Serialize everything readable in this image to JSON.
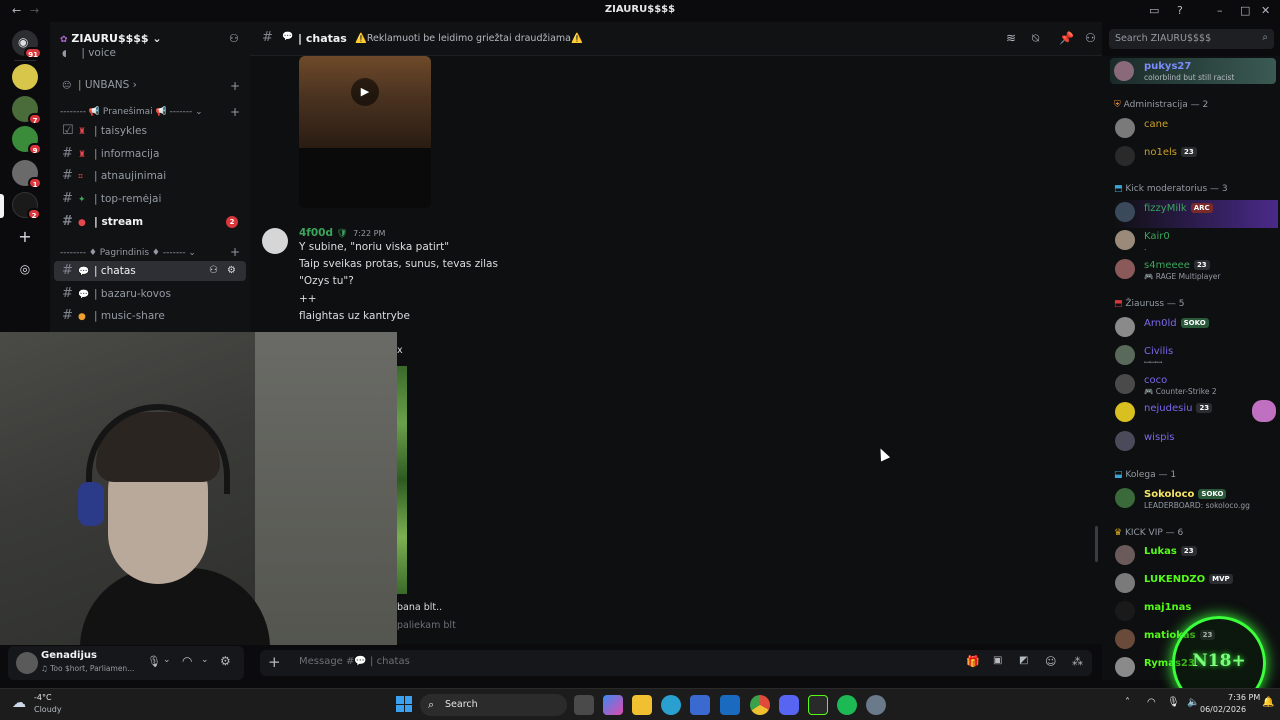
{
  "window": {
    "title": "ZIAURU$$$$"
  },
  "server": {
    "name": "ZIAURU$$$$"
  },
  "rail": {
    "badges": [
      "91",
      "7",
      "9",
      "1",
      "2"
    ]
  },
  "channels": {
    "voice_label": "| voice",
    "unbans": "| UNBANS",
    "cat_pranesimai": "Pranešimai",
    "items": [
      {
        "name": "| taisykles"
      },
      {
        "name": "| informacija"
      },
      {
        "name": "| atnaujinimai"
      },
      {
        "name": "| top-remėjai"
      },
      {
        "name": "| stream",
        "badge": "2"
      }
    ],
    "cat_pagrindinis": "Pagrindinis",
    "items2": [
      {
        "name": "| chatas"
      },
      {
        "name": "| bazaru-kovos"
      },
      {
        "name": "| music-share"
      }
    ]
  },
  "header": {
    "channel": "| chatas",
    "topic": "⚠️Reklamuoti be leidimo griežtai draudžiama⚠️",
    "search_placeholder": "Search ZIAURU$$$$"
  },
  "messages": {
    "author": "4f00d",
    "time": "7:22 PM",
    "lines": [
      "Y subine, \"noriu viska patirt\"",
      "Taip sveikas protas, sunus, tevas zilas",
      "\"Ozys tu\"?",
      "++",
      "flaightas uz kantrybe"
    ],
    "partial1": "x",
    "partial2": "bana blt..",
    "partial3": "paliekam blt"
  },
  "composer": {
    "placeholder_prefix": "Message #",
    "placeholder_channel": "| chatas"
  },
  "user": {
    "name": "Genadijus",
    "status": "Too $hort, Parliamen..."
  },
  "members": {
    "top": {
      "name": "pukys27",
      "status": "colorblind but still racist"
    },
    "groups": [
      {
        "role": "Administracija — 2",
        "members": [
          {
            "name": "cane",
            "color": "#c9a227"
          },
          {
            "name": "no1els",
            "color": "#c9a227",
            "tag": "23"
          }
        ]
      },
      {
        "role": "Kick moderatorius — 3",
        "members": [
          {
            "name": "fizzyMilk",
            "color": "#3ba55d",
            "tag": "ARC"
          },
          {
            "name": "Kair0",
            "color": "#3ba55d",
            "status": "."
          },
          {
            "name": "s4meeee",
            "color": "#3ba55d",
            "tag": "23",
            "status": "RAGE Multiplayer"
          }
        ]
      },
      {
        "role": "Žiauruss — 5",
        "members": [
          {
            "name": "Arn0ld",
            "color": "#7b68ee",
            "tag": "SOKO"
          },
          {
            "name": "Civilis",
            "color": "#7b68ee",
            "status": "ꟷꟷꟷ"
          },
          {
            "name": "coco",
            "color": "#7b68ee",
            "status": "Counter-Strike 2"
          },
          {
            "name": "nejudesiu",
            "color": "#7b68ee",
            "tag": "23"
          },
          {
            "name": "wispis",
            "color": "#7b68ee"
          }
        ]
      },
      {
        "role": "Kolega — 1",
        "members": [
          {
            "name": "Sokoloco",
            "color": "#f5e663",
            "tag": "SOKO",
            "status": "LEADERBOARD: sokoloco.gg"
          }
        ]
      },
      {
        "role": "KICK VIP — 6",
        "members": [
          {
            "name": "Lukas",
            "color": "#53fc18",
            "tag": "23"
          },
          {
            "name": "LUKENDZO",
            "color": "#53fc18",
            "tag": "MVP"
          },
          {
            "name": "maj1nas",
            "color": "#53fc18"
          },
          {
            "name": "matiokas",
            "color": "#53fc18",
            "tag": "23"
          },
          {
            "name": "Rymas23",
            "color": "#53fc18"
          }
        ]
      }
    ]
  },
  "taskbar": {
    "weather_temp": "-4°C",
    "weather_desc": "Cloudy",
    "search": "Search",
    "time": "7:36 PM",
    "date": "06/02/2026"
  },
  "overlay": {
    "logo": "N18+"
  },
  "icons": {
    "accent": "#5865f2",
    "kick_green": "#53fc18"
  }
}
